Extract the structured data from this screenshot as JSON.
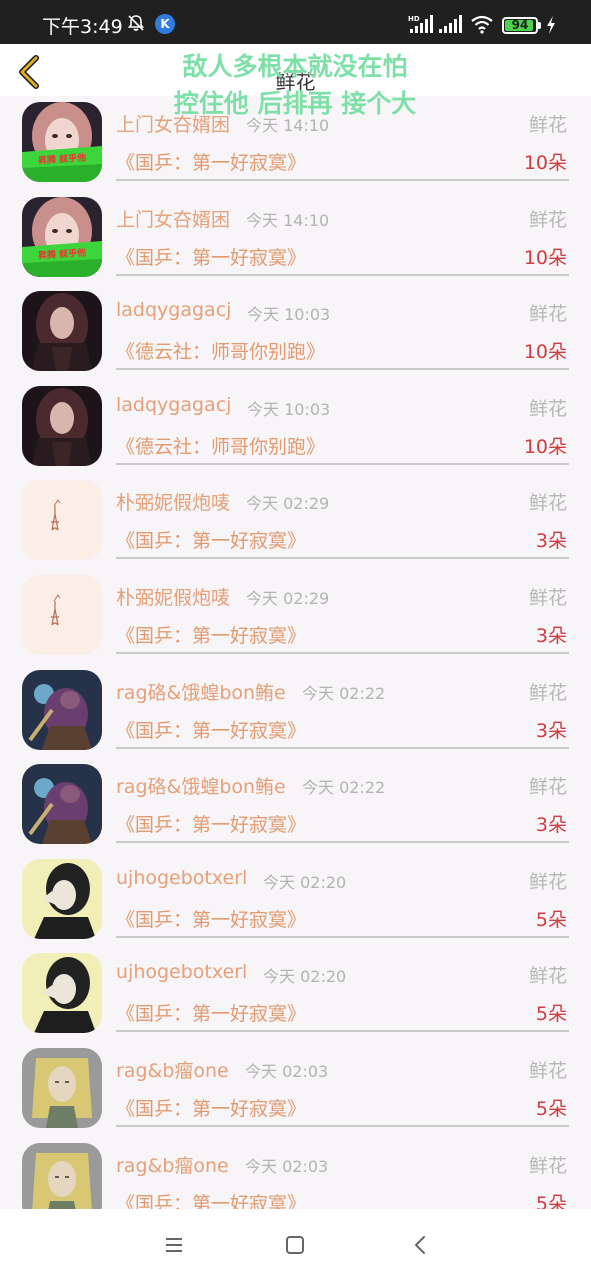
{
  "status_bar": {
    "time": "下午3:49",
    "k_badge": "K",
    "battery": "94",
    "battery_level": 0.94,
    "icons": [
      "bell-off-icon",
      "k-app-icon",
      "hd-signal-icon",
      "signal-icon",
      "wifi-icon",
      "battery-icon",
      "charging-icon"
    ]
  },
  "header": {
    "title": "鲜花",
    "back_icon": "chevron-left-icon",
    "overlay_line1": "敌人多根本就没在怕",
    "overlay_line2": "控住他 后排再 接个大"
  },
  "colors": {
    "name": "#e6a07a",
    "room": "#e39a6e",
    "count": "#d23b40",
    "overlay": "#7ee0a8",
    "accent_back": "#e0b020"
  },
  "list": [
    {
      "name": "上门女夻婿困",
      "time": "今天 14:10",
      "gift": "鲜花",
      "room": "《国乒：第一好寂寞》",
      "count": "10朵",
      "avatar": "girl-green-banner",
      "avatar_text": "昇腾 就乎他"
    },
    {
      "name": "上门女夻婿困",
      "time": "今天 14:10",
      "gift": "鲜花",
      "room": "《国乒：第一好寂寞》",
      "count": "10朵",
      "avatar": "girl-green-banner",
      "avatar_text": "昇腾 就乎他"
    },
    {
      "name": "ladqygagacj",
      "time": "今天 10:03",
      "gift": "鲜花",
      "room": "《德云社：师哥你别跑》",
      "count": "10朵",
      "avatar": "dark-hair-girl"
    },
    {
      "name": "ladqygagacj",
      "time": "今天 10:03",
      "gift": "鲜花",
      "room": "《德云社：师哥你别跑》",
      "count": "10朵",
      "avatar": "dark-hair-girl"
    },
    {
      "name": "朴弼妮假炮唛",
      "time": "今天 02:29",
      "gift": "鲜花",
      "room": "《国乒：第一好寂寞》",
      "count": "3朵",
      "avatar": "eiffel-tower"
    },
    {
      "name": "朴弼妮假炮唛",
      "time": "今天 02:29",
      "gift": "鲜花",
      "room": "《国乒：第一好寂寞》",
      "count": "3朵",
      "avatar": "eiffel-tower"
    },
    {
      "name": "rag硌&饿蝗bon鲔e",
      "time": "今天 02:22",
      "gift": "鲜花",
      "room": "《国乒：第一好寂寞》",
      "count": "3朵",
      "avatar": "game-warrior"
    },
    {
      "name": "rag硌&饿蝗bon鲔e",
      "time": "今天 02:22",
      "gift": "鲜花",
      "room": "《国乒：第一好寂寞》",
      "count": "3朵",
      "avatar": "game-warrior"
    },
    {
      "name": "ujhogebotxerl",
      "time": "今天 02:20",
      "gift": "鲜花",
      "room": "《国乒：第一好寂寞》",
      "count": "5朵",
      "avatar": "bw-girl-pose"
    },
    {
      "name": "ujhogebotxerl",
      "time": "今天 02:20",
      "gift": "鲜花",
      "room": "《国乒：第一好寂寞》",
      "count": "5朵",
      "avatar": "bw-girl-pose"
    },
    {
      "name": "rag&b瘤one",
      "time": "今天 02:03",
      "gift": "鲜花",
      "room": "《国乒：第一好寂寞》",
      "count": "5朵",
      "avatar": "anime-blonde"
    },
    {
      "name": "rag&b瘤one",
      "time": "今天 02:03",
      "gift": "鲜花",
      "room": "《国乒：第一好寂寞》",
      "count": "5朵",
      "avatar": "anime-blonde"
    }
  ],
  "nav": {
    "icons": [
      "menu-icon",
      "home-square-icon",
      "back-triangle-icon"
    ]
  }
}
